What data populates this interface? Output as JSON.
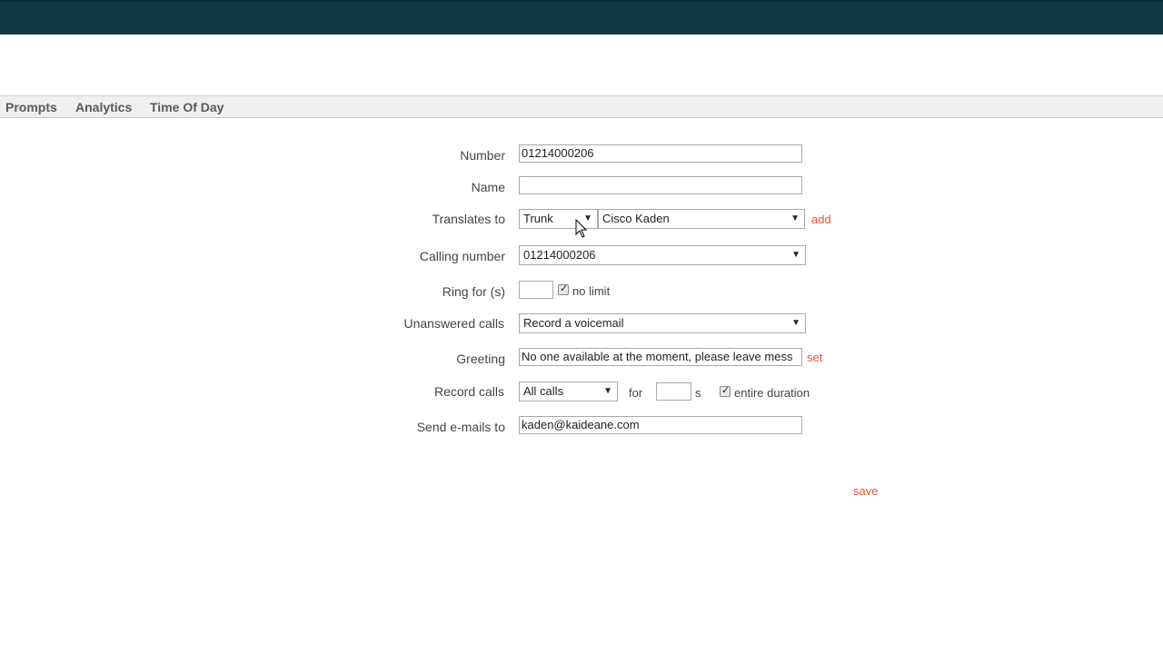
{
  "nav": {
    "items": [
      "Prompts",
      "Analytics",
      "Time Of Day"
    ]
  },
  "form": {
    "number": {
      "label": "Number",
      "value": "01214000206"
    },
    "name": {
      "label": "Name",
      "value": ""
    },
    "translates_to": {
      "label": "Translates to",
      "type_value": "Trunk",
      "target_value": "Cisco Kaden",
      "add_label": "add"
    },
    "calling_number": {
      "label": "Calling number",
      "value": "01214000206"
    },
    "ring_for": {
      "label": "Ring for (s)",
      "value": "",
      "no_limit_label": "no limit",
      "no_limit_checked": true
    },
    "unanswered_calls": {
      "label": "Unanswered calls",
      "value": "Record a voicemail"
    },
    "greeting": {
      "label": "Greeting",
      "value": "No one available at the moment, please leave mess",
      "set_label": "set"
    },
    "record_calls": {
      "label": "Record calls",
      "value": "All calls",
      "for_label": "for",
      "seconds_value": "",
      "seconds_unit": "s",
      "entire_duration_label": "entire duration",
      "entire_duration_checked": true
    },
    "send_emails": {
      "label": "Send e-mails to",
      "value": "kaden@kaideane.com"
    }
  },
  "actions": {
    "save_label": "save"
  },
  "colors": {
    "topbar": "#0f3a45",
    "link": "#e8563a",
    "nav_bg": "#efefef"
  },
  "icons": {
    "cursor": "mouse-pointer-icon",
    "dropdown": "chevron-down-icon",
    "checkbox": "checkmark-icon"
  }
}
